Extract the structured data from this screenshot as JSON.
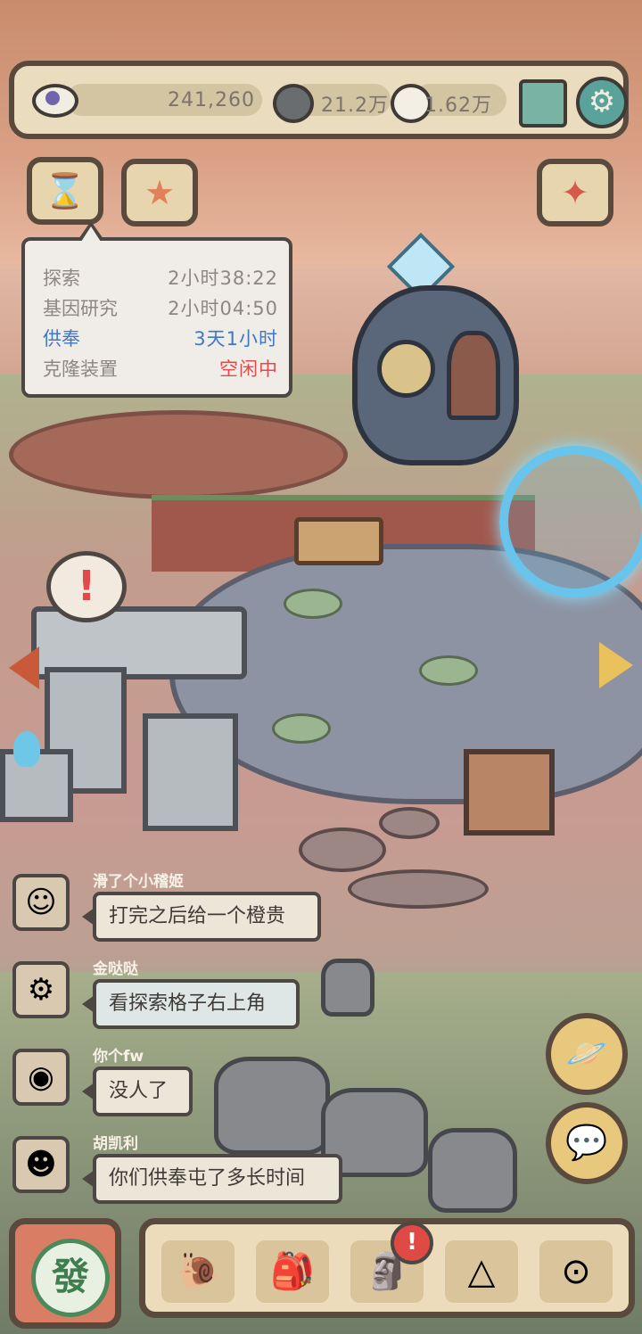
{
  "resources": {
    "eye_points": "241,260",
    "dark_bubbles": "21.2万",
    "light_bubbles": "1.62万"
  },
  "icons": {
    "eye": "eye-icon",
    "dark_bubble": "dark-chat-bubble-icon",
    "light_bubble": "light-chat-bubble-icon",
    "mail": "mail-icon",
    "settings": "gear-icon",
    "hourglass": "hourglass-icon",
    "star": "starfish-icon",
    "party": "party-popper-icon"
  },
  "timers_popup": {
    "rows": [
      {
        "label": "探索",
        "value": "2小时38:22",
        "style": "normal"
      },
      {
        "label": "基因研究",
        "value": "2小时04:50",
        "style": "normal"
      },
      {
        "label": "供奉",
        "value": "3天1小时",
        "style": "highlight"
      },
      {
        "label": "克隆装置",
        "value": "空闲中",
        "style": "idle"
      }
    ]
  },
  "alert_bubble": "!",
  "chat": [
    {
      "user": "滑了个小稽姬",
      "message": "打完之后给一个橙贵",
      "avatar": "elf-avatar"
    },
    {
      "user": "金哒哒",
      "message": "看探索格子右上角",
      "avatar": "robot-avatar"
    },
    {
      "user": "你个fw",
      "message": "没人了",
      "avatar": "snail-avatar"
    },
    {
      "user": "胡凯利",
      "message": "你们供奉屯了多长时间",
      "avatar": "frog-avatar"
    }
  ],
  "side_buttons": {
    "planet": "planet-icon",
    "chat": "chat-icon"
  },
  "bottom_nav": {
    "main_label": "發",
    "items": [
      "snail-icon",
      "backpack-icon",
      "bust-statue-icon",
      "pyramid-eye-icon",
      "key-coin-icon"
    ],
    "badge": "!"
  },
  "colors": {
    "frame": "#5a4a3d",
    "panel": "#e9dcbf",
    "highlight_blue": "#3e78c6",
    "idle_red": "#e44c4c"
  }
}
